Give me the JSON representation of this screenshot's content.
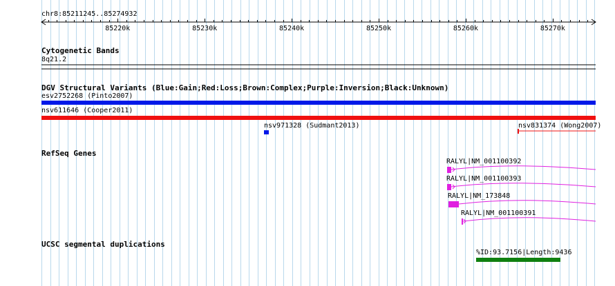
{
  "ruler": {
    "position_label": "chr8:85211245..85274932",
    "ticks": [
      {
        "label": "85220k",
        "value": 85220000
      },
      {
        "label": "85230k",
        "value": 85230000
      },
      {
        "label": "85240k",
        "value": 85240000
      },
      {
        "label": "85250k",
        "value": 85250000
      },
      {
        "label": "85260k",
        "value": 85260000
      },
      {
        "label": "85270k",
        "value": 85270000
      }
    ]
  },
  "tracks": {
    "cytoband": {
      "title": "Cytogenetic Bands",
      "band_label": "8q21.2"
    },
    "dgv": {
      "title": "DGV Structural Variants (Blue:Gain;Red:Loss;Brown:Complex;Purple:Inversion;Black:Unknown)",
      "features": [
        {
          "label": "esv2752268 (Pinto2007)",
          "color": "#0018e8"
        },
        {
          "label": "nsv611646 (Cooper2011)",
          "color": "#f01010"
        },
        {
          "label": "nsv971328 (Sudmant2013)",
          "color": "#0018e8"
        },
        {
          "label": "nsv831374 (Wong2007)",
          "color": "#f01010"
        }
      ]
    },
    "refseq": {
      "title": "RefSeq Genes",
      "color": "#e020e0",
      "features": [
        {
          "label": "RALYL|NM_001100392"
        },
        {
          "label": "RALYL|NM_001100393"
        },
        {
          "label": "RALYL|NM_173848"
        },
        {
          "label": "RALYL|NM_001100391"
        }
      ]
    },
    "segdup": {
      "title": "UCSC segmental duplications",
      "color": "#108010",
      "features": [
        {
          "label": "%ID:93.7156|Length:9436"
        }
      ]
    }
  },
  "colors": {
    "grid_line": "#b8d8ec",
    "ruler": "#000000"
  }
}
